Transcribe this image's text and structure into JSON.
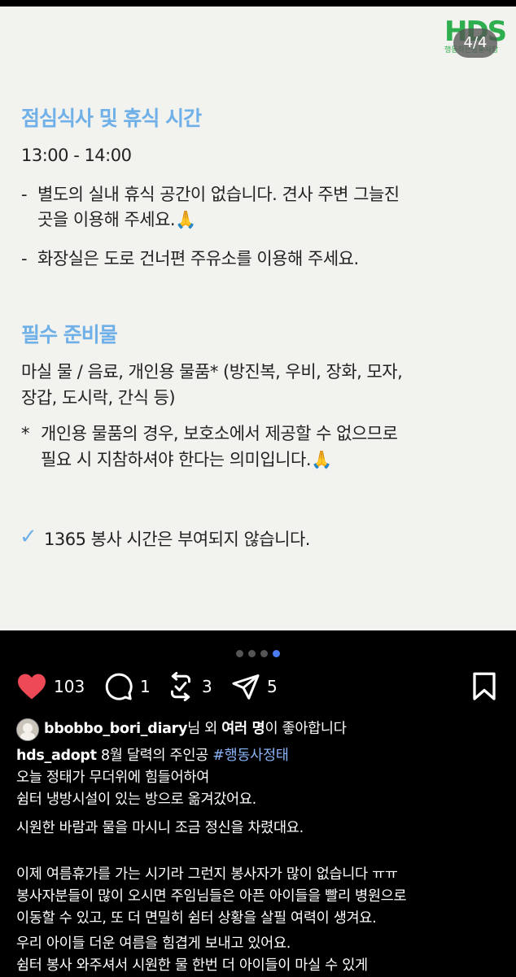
{
  "slide": {
    "logo_text": "HDS",
    "logo_sub": "행동하는동물사랑",
    "counter": "4/4",
    "section1_title": "점심식사 및 휴식 시간",
    "section1_time": "13:00 - 14:00",
    "bullet1_line1": "별도의 실내 휴식 공간이 없습니다. 견사 주변 그늘진",
    "bullet1_line2": "곳을 이용해 주세요.🙏",
    "bullet2": "화장실은 도로 건너편 주유소를 이용해 주세요.",
    "section2_title": "필수 준비물",
    "items_line1": "마실 물 / 음료, 개인용 물품* (방진복, 우비, 장화, 모자,",
    "items_line2": "장갑, 도시락, 간식 등)",
    "note_line1": "개인용 물품의 경우, 보호소에서 제공할 수 없으므로",
    "note_line2": "필요 시 지참하셔야 한다는 의미입니다.🙏",
    "volunteer_note": "1365 봉사 시간은 부여되지 않습니다.",
    "dash": "-",
    "asterisk": "*",
    "check": "✓"
  },
  "carousel": {
    "total": 4,
    "active": 4
  },
  "actions": {
    "likes": "103",
    "comments": "1",
    "reposts": "3",
    "shares": "5"
  },
  "liked_by": {
    "user": "bbobbo_bori_diary",
    "middle": "님 외 ",
    "others": "여러 명",
    "suffix": "이 좋아합니다"
  },
  "caption": {
    "author": "hds_adopt",
    "text": " 8월 달력의 주인공 ",
    "hashtag": "#행동사정태",
    "lines": [
      "오늘 정태가 무더위에 힘들어하여",
      "쉼터 냉방시설이 있는 방으로 옮겨갔어요.",
      "시원한 바람과 물을 마시니 조금 정신을 차렸대요.",
      "",
      "이제 여름휴가를 가는 시기라 그런지 봉사자가 많이 없습니다 ㅠㅠ",
      "봉사자분들이 많이 오시면 주임님들은 아픈 아이들을 빨리 병원으로",
      "이동할 수 있고, 또 더 면밀히 쉼터 상황을 살필 여력이 생겨요.",
      "우리 아이들 더운 여름을 힘겹게 보내고 있어요.",
      "쉼터 봉사 와주셔서 시원한 물 한번 더 아이들이 마실 수 있게"
    ]
  },
  "colors": {
    "accent": "#6fb0e8",
    "logo": "#2fae4f",
    "like": "#ed4956",
    "hashtag": "#8ab4f8"
  }
}
